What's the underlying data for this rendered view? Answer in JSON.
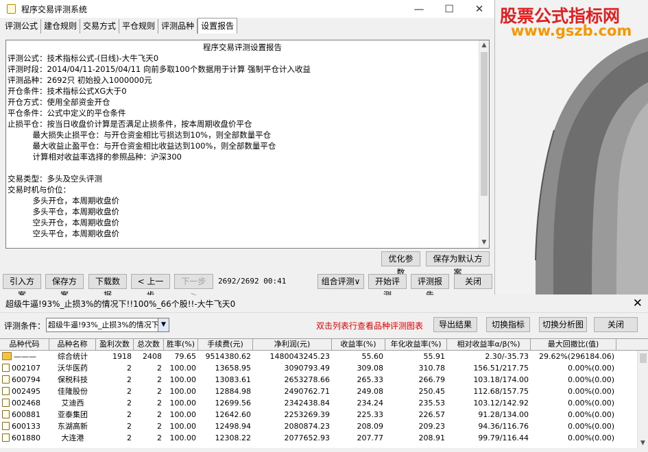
{
  "window": {
    "title": "程序交易评测系统",
    "minimize": "—",
    "maximize": "☐",
    "close": "✕"
  },
  "tabs": [
    "评测公式",
    "建仓规则",
    "交易方式",
    "平仓规则",
    "评测品种",
    "设置报告"
  ],
  "report": {
    "title": "程序交易评测设置报告",
    "lines": [
      "评测公式：技术指标公式-(日线)-大牛飞天0",
      "评测时段：2014/04/11-2015/04/11 向前多取100个数据用于计算 强制平仓计入收益",
      "评测品种：2692只 初始投入1000000元",
      "开仓条件：技术指标公式XG大于0",
      "开仓方式：使用全部资金开仓",
      "平仓条件：公式中定义的平仓条件",
      "止损平仓：按当日收盘价计算是否满足止损条件，按本周期收盘价平仓",
      "          最大损失止损平仓：与开仓资金相比亏损达到10%，则全部数量平仓",
      "          最大收益止盈平仓：与开仓资金相比收益达到100%，则全部数量平仓",
      "          计算相对收益率选择的参照品种：沪深300",
      "",
      "交易类型：多头及空头评测",
      "交易时机与价位：",
      "          多头开仓，本周期收盘价",
      "          多头平仓，本周期收盘价",
      "          空头开仓，本周期收盘价",
      "          空头平仓，本周期收盘价"
    ]
  },
  "buttons": {
    "optimize": "优化参数",
    "save_default": "保存为默认方案",
    "import": "引入方案",
    "save": "保存方案",
    "download": "下载数据",
    "prev": "< 上一步",
    "next": "下一步 >",
    "combo": "组合评测∨",
    "start": "开始评测",
    "report": "评测报告",
    "close": "关闭"
  },
  "status": {
    "progress": "2692/2692 00:41"
  },
  "watermark": {
    "line1": "股票公式指标网",
    "line2": "www.gszb.com"
  },
  "result": {
    "title": "超级牛逼!93%_止损3%的情况下!!100%_66个股!!-大牛飞天0",
    "close_icon": "✕",
    "cond_label": "评测条件：",
    "cond_value": "超级牛逼!93%_止损3%的情况下",
    "hint": "双击列表行查看品种评测图表",
    "btn_export": "导出结果",
    "btn_switch_indicator": "切换指标",
    "btn_switch_chart": "切换分析图",
    "btn_close": "关闭"
  },
  "table": {
    "headers": [
      "品种代码",
      "品种名称",
      "盈利次数",
      "总次数",
      "胜率(%)",
      "手续费(元)",
      "净利润(元)",
      "收益率(%)",
      "年化收益率(%)",
      "相对收益率α/β(%)",
      "最大回撤比(值)"
    ],
    "rows": [
      [
        "———",
        "综合统计",
        "1918",
        "2408",
        "79.65",
        "9514380.62",
        "1480043245.23",
        "55.60",
        "55.91",
        "2.30/-35.73",
        "29.62%(296184.06)"
      ],
      [
        "002107",
        "沃华医药",
        "2",
        "2",
        "100.00",
        "13658.95",
        "3090793.49",
        "309.08",
        "310.78",
        "156.51/217.75",
        "0.00%(0.00)"
      ],
      [
        "600794",
        "保税科技",
        "2",
        "2",
        "100.00",
        "13083.61",
        "2653278.66",
        "265.33",
        "266.79",
        "103.18/174.00",
        "0.00%(0.00)"
      ],
      [
        "002495",
        "佳隆股份",
        "2",
        "2",
        "100.00",
        "12884.98",
        "2490762.71",
        "249.08",
        "250.45",
        "112.68/157.75",
        "0.00%(0.00)"
      ],
      [
        "002468",
        "艾迪西",
        "2",
        "2",
        "100.00",
        "12699.56",
        "2342438.84",
        "234.24",
        "235.53",
        "103.12/142.92",
        "0.00%(0.00)"
      ],
      [
        "600881",
        "亚泰集团",
        "2",
        "2",
        "100.00",
        "12642.60",
        "2253269.39",
        "225.33",
        "226.57",
        "91.28/134.00",
        "0.00%(0.00)"
      ],
      [
        "600133",
        "东湖高新",
        "2",
        "2",
        "100.00",
        "12498.94",
        "2080874.23",
        "208.09",
        "209.23",
        "94.36/116.76",
        "0.00%(0.00)"
      ],
      [
        "601880",
        "大连港",
        "2",
        "2",
        "100.00",
        "12308.22",
        "2077652.93",
        "207.77",
        "208.91",
        "99.79/116.44",
        "0.00%(0.00)"
      ]
    ]
  }
}
